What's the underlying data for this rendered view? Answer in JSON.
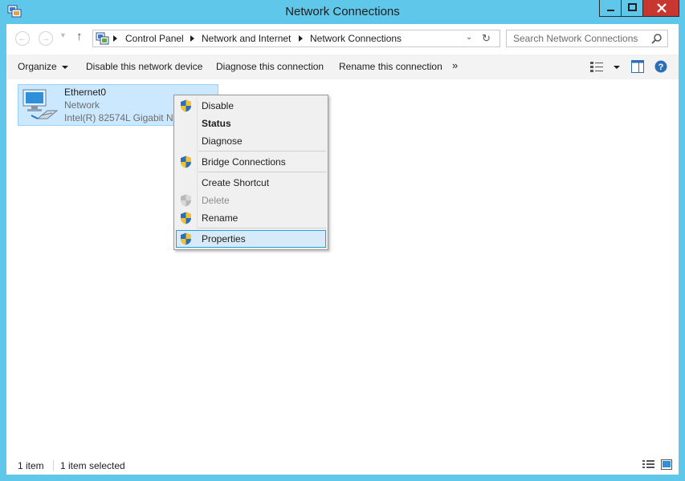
{
  "window": {
    "title": "Network Connections",
    "colors": {
      "frame": "#5fc7ea",
      "close": "#c7372f",
      "selection": "#cce8ff",
      "menu_highlight": "#d7eaf9"
    }
  },
  "address": {
    "crumbs": [
      "Control Panel",
      "Network and Internet",
      "Network Connections"
    ]
  },
  "search": {
    "placeholder": "Search Network Connections"
  },
  "commands": {
    "organize": "Organize",
    "disable": "Disable this network device",
    "diagnose": "Diagnose this connection",
    "rename": "Rename this connection",
    "more": "»"
  },
  "item": {
    "name": "Ethernet0",
    "status": "Network",
    "device": "Intel(R) 82574L Gigabit Network Connection",
    "icon": "network-adapter-icon"
  },
  "context_menu": {
    "items": [
      {
        "label": "Disable",
        "icon": "uac-shield-icon"
      },
      {
        "label": "Status",
        "default": true
      },
      {
        "label": "Diagnose"
      },
      {
        "label": "Bridge Connections",
        "icon": "uac-shield-icon"
      },
      {
        "label": "Create Shortcut"
      },
      {
        "label": "Delete",
        "icon": "uac-shield-icon",
        "disabled": true
      },
      {
        "label": "Rename",
        "icon": "uac-shield-icon"
      },
      {
        "label": "Properties",
        "icon": "uac-shield-icon",
        "highlighted": true
      }
    ]
  },
  "status": {
    "count": "1 item",
    "selected": "1 item selected"
  }
}
